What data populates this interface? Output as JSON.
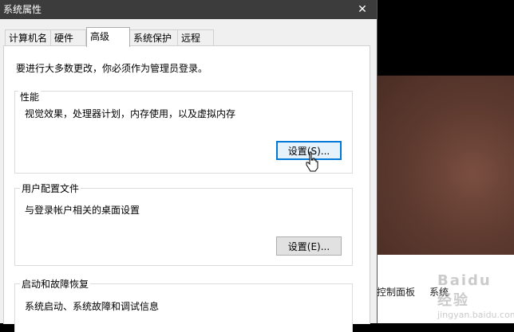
{
  "window": {
    "title": "系统属性",
    "close_glyph": "✕"
  },
  "tabs": [
    {
      "label": "计算机名"
    },
    {
      "label": "硬件"
    },
    {
      "label": "高级"
    },
    {
      "label": "系统保护"
    },
    {
      "label": "远程"
    }
  ],
  "active_tab": "高级",
  "admin_note": "要进行大多数更改，你必须作为管理员登录。",
  "performance": {
    "label": "性能",
    "description": "视觉效果，处理器计划，内存使用，以及虚拟内存",
    "button": "设置(S)..."
  },
  "user_profiles": {
    "label": "用户配置文件",
    "description": "与登录帐户相关的桌面设置",
    "button": "设置(E)..."
  },
  "startup_recovery": {
    "label": "启动和故障恢复",
    "description": "系统启动、系统故障和调试信息"
  },
  "background": {
    "links": [
      "控制面板",
      "系统"
    ],
    "watermark": {
      "line1": "Baidu经验",
      "line2": "jingyan.baidu.com"
    }
  }
}
